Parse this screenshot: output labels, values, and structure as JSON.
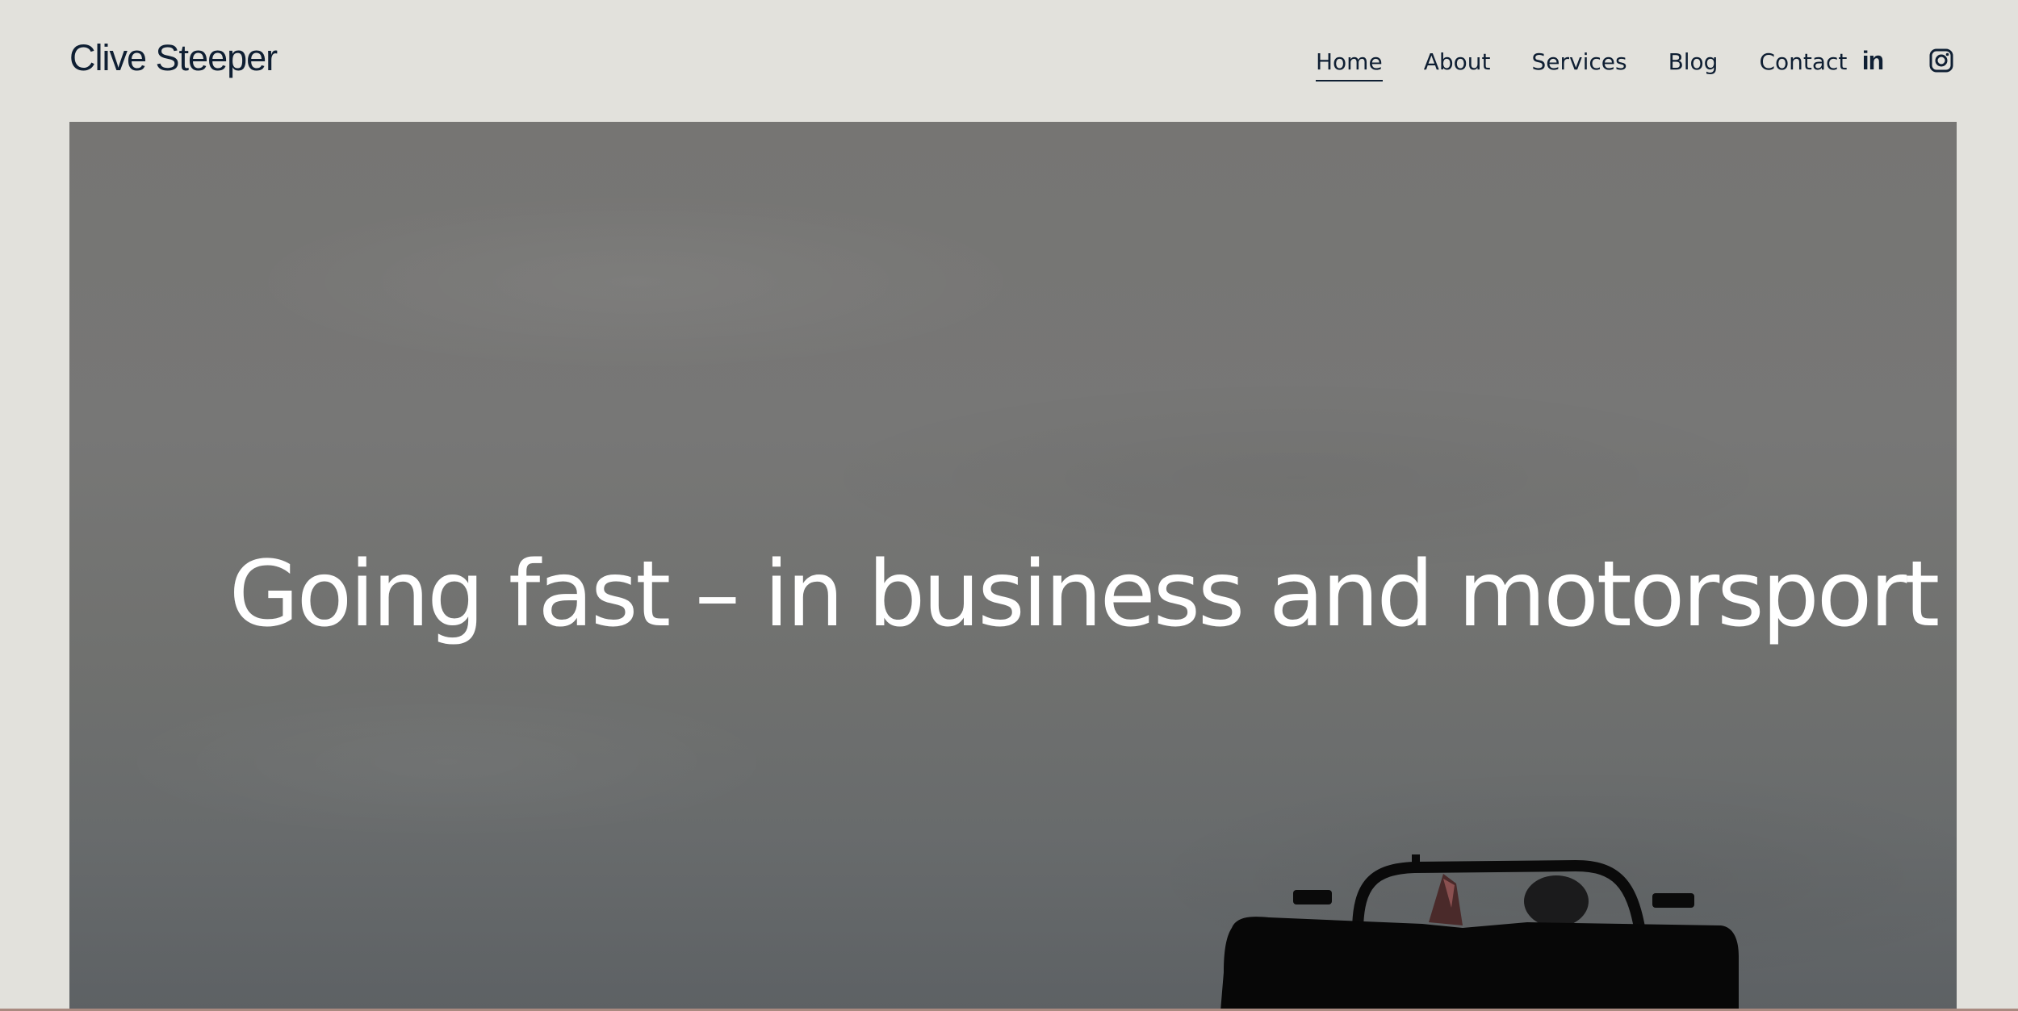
{
  "header": {
    "site_title": "Clive Steeper",
    "nav": {
      "items": [
        {
          "label": "Home",
          "active": true
        },
        {
          "label": "About",
          "active": false
        },
        {
          "label": "Services",
          "active": false
        },
        {
          "label": "Blog",
          "active": false
        },
        {
          "label": "Contact",
          "active": false
        }
      ]
    },
    "social": {
      "linkedin_label": "in",
      "linkedin_icon": "linkedin-icon",
      "instagram_icon": "instagram-icon"
    }
  },
  "hero": {
    "heading": "Going fast – in business and motorsport",
    "background_image": "overcast sky with silhouette of open-top race car"
  },
  "colors": {
    "page_background": "#e2e1dc",
    "text_dark": "#0f1f33",
    "hero_text": "#ffffff"
  }
}
